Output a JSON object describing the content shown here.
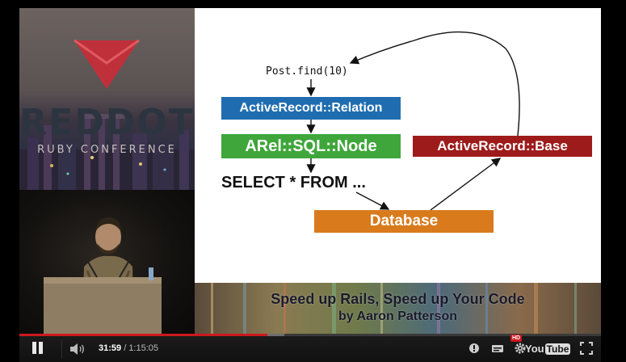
{
  "window": {
    "title": "Speed up Rails, Speed up Your Code"
  },
  "branding": {
    "title": "REDDOT",
    "subtitle": "RUBY CONFERENCE",
    "logo_color": "#c0303a"
  },
  "slide": {
    "code_line": "Post.find(10)",
    "relation_box": "ActiveRecord::Relation",
    "node_box": "ARel::SQL::Node",
    "base_box": "ActiveRecord::Base",
    "select_text": "SELECT * FROM ...",
    "database_box": "Database",
    "colors": {
      "relation": "#1f6db0",
      "node": "#3ea63a",
      "base": "#9e1b1b",
      "database": "#d97b1d"
    }
  },
  "banner": {
    "title": "Speed up Rails, Speed up Your Code",
    "subtitle": "by Aaron Patterson"
  },
  "player": {
    "current_time": "31:59",
    "separator": " / ",
    "duration": "1:15:05",
    "progress_played_fraction": 0.426,
    "progress_loaded_fraction": 0.455,
    "hd_badge": "HD",
    "logo_you": "You",
    "logo_tube": "Tube",
    "accent_color": "#cc181e",
    "icons": [
      "pause-icon",
      "volume-icon",
      "annotations-icon",
      "captions-icon",
      "settings-icon",
      "youtube-logo",
      "fullscreen-icon"
    ]
  }
}
